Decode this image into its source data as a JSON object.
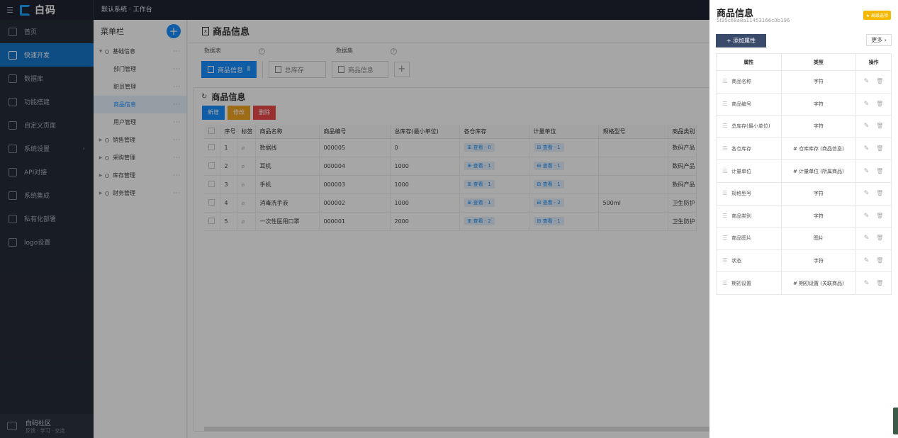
{
  "topbar": {
    "brand": "白码",
    "title": "默认系统 · 工作台"
  },
  "nav": {
    "items": [
      {
        "label": "首页",
        "icon": "home-icon"
      },
      {
        "label": "快速开发",
        "icon": "cube-icon",
        "active": true
      },
      {
        "label": "数据库",
        "icon": "database-icon"
      },
      {
        "label": "功能搭建",
        "icon": "build-icon"
      },
      {
        "label": "自定义页面",
        "icon": "page-icon"
      },
      {
        "label": "系统设置",
        "icon": "settings-icon",
        "arrow": "›"
      },
      {
        "label": "API对接",
        "icon": "api-icon"
      },
      {
        "label": "系统集成",
        "icon": "integration-icon"
      },
      {
        "label": "私有化部署",
        "icon": "deploy-icon"
      },
      {
        "label": "logo设置",
        "icon": "logo-icon"
      }
    ],
    "community": {
      "title": "白码社区",
      "subtitle": "反馈 · 学习 · 交流"
    }
  },
  "menu": {
    "title": "菜单栏",
    "add": "+",
    "items": [
      {
        "label": "基础信息",
        "type": "group",
        "caret": "▼"
      },
      {
        "label": "部门管理",
        "type": "child"
      },
      {
        "label": "职员管理",
        "type": "child"
      },
      {
        "label": "商品信息",
        "type": "child",
        "active": true
      },
      {
        "label": "用户管理",
        "type": "child"
      },
      {
        "label": "销售管理",
        "type": "group",
        "caret": "▶"
      },
      {
        "label": "采购管理",
        "type": "group",
        "caret": "▶"
      },
      {
        "label": "库存管理",
        "type": "group",
        "caret": "▶"
      },
      {
        "label": "财务管理",
        "type": "group",
        "caret": "▶"
      }
    ],
    "dots": "···"
  },
  "main": {
    "page_title": "商品信息",
    "ds_table_label": "数据表",
    "ds_set_label": "数据集",
    "tabs": [
      "商品信息",
      "总库存",
      "商品信息"
    ],
    "grid_title": "商品信息",
    "buttons": {
      "add": "新增",
      "edit": "修改",
      "delete": "删除"
    },
    "columns": [
      "序号",
      "标签",
      "商品名称",
      "商品编号",
      "总库存(最小单位)",
      "各仓库存",
      "计量单位",
      "规格型号",
      "商品类别"
    ],
    "rows": [
      {
        "n": "1",
        "name": "数据线",
        "code": "000005",
        "stock": "0",
        "warehouse": "⊞ 查看 · 0",
        "unit": "⊞ 查看 · 1",
        "spec": "",
        "cat": "数码产品"
      },
      {
        "n": "2",
        "name": "耳机",
        "code": "000004",
        "stock": "1000",
        "warehouse": "⊞ 查看 · 1",
        "unit": "⊞ 查看 · 1",
        "spec": "",
        "cat": "数码产品"
      },
      {
        "n": "3",
        "name": "手机",
        "code": "000003",
        "stock": "1000",
        "warehouse": "⊞ 查看 · 1",
        "unit": "⊞ 查看 · 1",
        "spec": "",
        "cat": "数码产品"
      },
      {
        "n": "4",
        "name": "消毒洗手液",
        "code": "000002",
        "stock": "1000",
        "warehouse": "⊞ 查看 · 1",
        "unit": "⊞ 查看 · 2",
        "spec": "500ml",
        "cat": "卫生防护"
      },
      {
        "n": "5",
        "name": "一次性医用口罩",
        "code": "000001",
        "stock": "2000",
        "warehouse": "⊞ 查看 · 2",
        "unit": "⊞ 查看 · 1",
        "spec": "",
        "cat": "卫生防护"
      }
    ]
  },
  "panel": {
    "title": "商品信息",
    "id": "5f35c68a8a11453166c0b196",
    "badge": "★ 高级选项",
    "add_button": "+ 添加属性",
    "more_button": "更多 ›",
    "columns": {
      "attr": "属性",
      "type": "类型",
      "ops": "操作"
    },
    "attributes": [
      {
        "name": "商品名称",
        "type": "字符"
      },
      {
        "name": "商品编号",
        "type": "字符"
      },
      {
        "name": "总库存(最小单位)",
        "type": "字符"
      },
      {
        "name": "各仓库存",
        "type": "# 仓库库存 (商品信息)"
      },
      {
        "name": "计量单位",
        "type": "# 计量单位 (所属商品)"
      },
      {
        "name": "规格型号",
        "type": "字符"
      },
      {
        "name": "商品类别",
        "type": "字符"
      },
      {
        "name": "商品图片",
        "type": "图片"
      },
      {
        "name": "状态",
        "type": "字符"
      },
      {
        "name": "期初设置",
        "type": "# 期初设置 (关联商品)"
      }
    ]
  },
  "colors": {
    "accent": "#1890ff",
    "nav_bg": "#262b36",
    "topbar_bg": "#1f2430"
  }
}
